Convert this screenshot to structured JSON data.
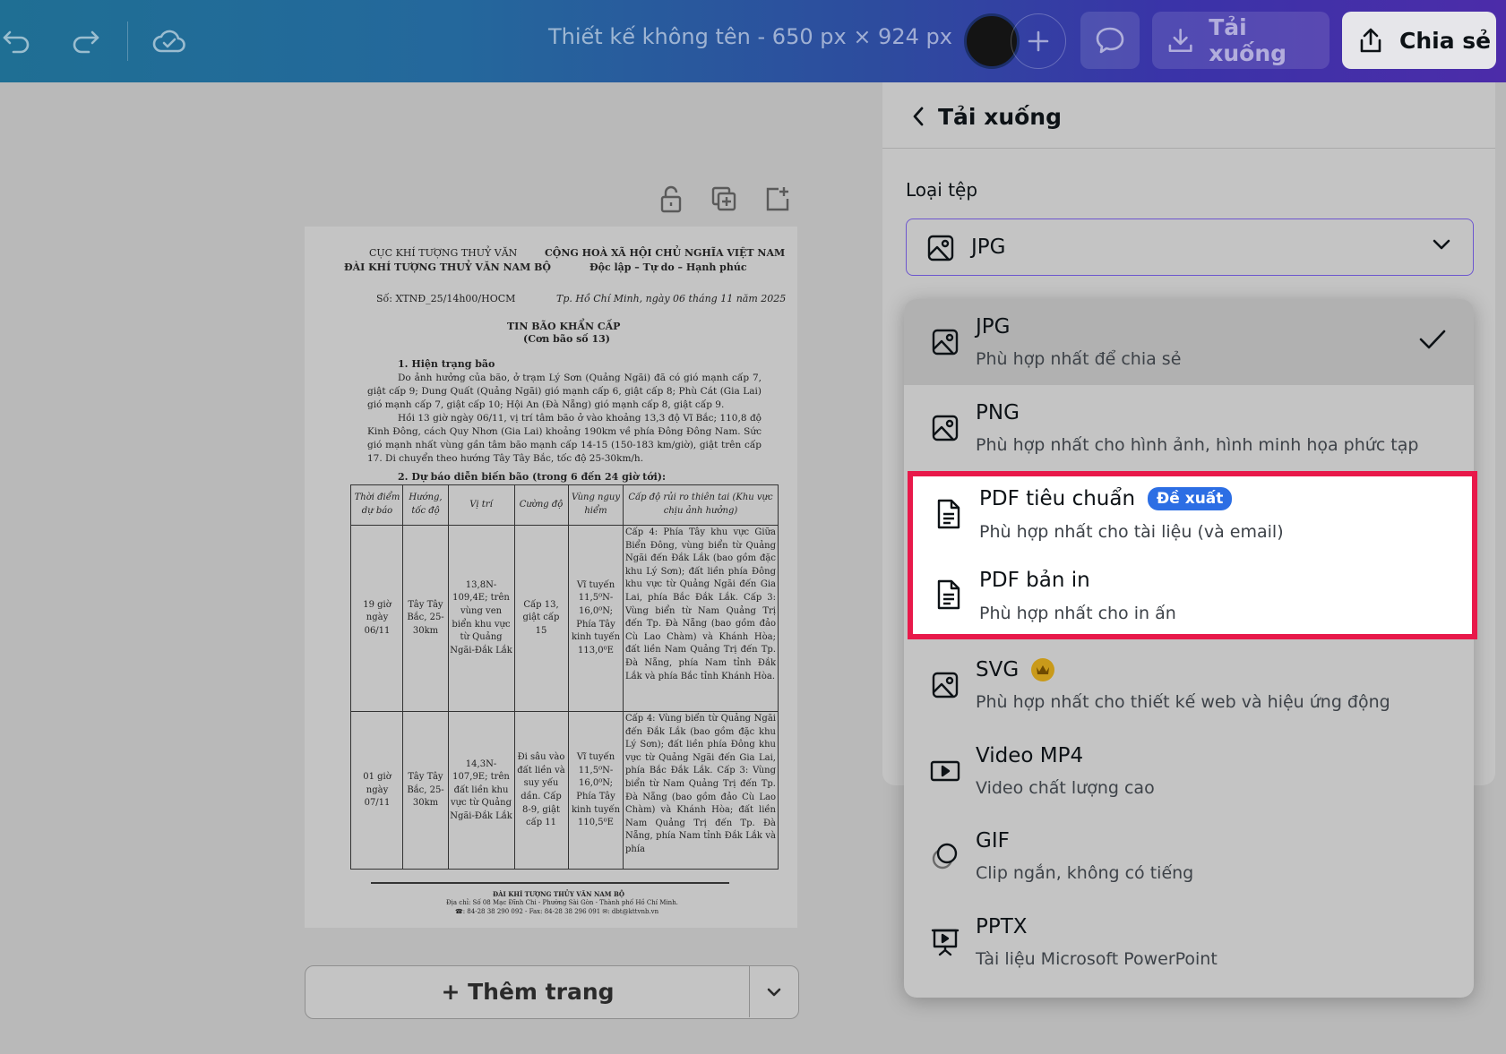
{
  "topbar": {
    "title": "Thiết kế không tên - 650 px × 924 px",
    "download_label": "Tải xuống",
    "share_label": "Chia sẻ"
  },
  "canvas": {
    "add_page_label": "+ Thêm trang"
  },
  "document": {
    "org_left_1": "CỤC KHÍ TƯỢNG THUỶ VĂN",
    "org_left_2": "ĐÀI KHÍ TƯỢNG THUỶ VĂN NAM BỘ",
    "org_right_1": "CỘNG HOÀ XÃ HỘI CHỦ NGHĨA VIỆT NAM",
    "org_right_2": "Độc lập – Tự do – Hạnh phúc",
    "number": "Số: XTNĐ_25/14h00/HOCM",
    "date": "Tp. Hồ Chí Minh, ngày 06 tháng 11 năm 2025",
    "heading_1": "TIN BÃO KHẨN CẤP",
    "heading_2": "(Cơn bão số 13)",
    "section_1": "1.  Hiện trạng bão",
    "para_1": "Do ảnh hưởng của bão, ở trạm Lý Sơn (Quảng Ngãi) đã có gió mạnh cấp 7, giật cấp 9; Dung Quất (Quảng Ngãi) gió mạnh cấp 6, giật cấp 8; Phù Cát (Gia Lai) gió mạnh cấp 7, giật cấp 10; Hội An (Đà Nẵng) gió mạnh cấp 8, giật cấp 9.",
    "para_2": "Hồi 13 giờ ngày 06/11, vị trí tâm bão ở vào khoảng 13,3 độ Vĩ Bắc; 110,8 độ Kinh Đông, cách Quy Nhơn (Gia Lai) khoảng 190km về phía Đông Đông Nam. Sức gió mạnh nhất vùng gần tâm bão mạnh cấp 14-15 (150-183 km/giờ), giật trên cấp 17. Di chuyển theo hướng Tây Tây Bắc, tốc độ 25-30km/h.",
    "section_2": "2. Dự báo diễn biến bão (trong 6 đến 24 giờ tới):",
    "table_header": [
      "Thời điểm dự báo",
      "Hướng, tốc độ",
      "Vị trí",
      "Cường độ",
      "Vùng nguy hiểm",
      "Cấp độ rủi ro thiên tai (Khu vực chịu ảnh hưởng)"
    ],
    "row_1": [
      "19 giờ ngày 06/11",
      "Tây Tây Bắc, 25-30km",
      "13,8N-109,4E; trên vùng ven biển khu vực từ Quảng Ngãi-Đắk Lắk",
      "Cấp 13, giật cấp 15",
      "Vĩ tuyến 11,5⁰N-16,0⁰N; Phía Tây kinh tuyến 113,0⁰E",
      "Cấp 4: Phía Tây khu vực Giữa Biển Đông, vùng biển từ Quảng Ngãi đến Đắk Lắk (bao gồm đặc khu Lý Sơn); đất liền phía Đông khu vực từ Quảng Ngãi đến Gia Lai, phía Bắc Đắk Lắk. Cấp 3: Vùng biển từ Nam Quảng Trị đến Tp. Đà Nẵng (bao gồm đảo Cù Lao Chàm) và Khánh Hòa; đất liền Nam Quảng Trị đến Tp. Đà Nẵng, phía Nam tỉnh Đắk Lắk và phía Bắc tỉnh Khánh Hòa."
    ],
    "row_2": [
      "01 giờ ngày 07/11",
      "Tây Tây Bắc, 25-30km",
      "14,3N-107,9E; trên đất liền khu vực từ Quảng Ngãi-Đắk Lắk",
      "Đi sâu vào đất liền và suy yếu dần. Cấp 8-9, giật cấp 11",
      "Vĩ tuyến 11,5⁰N-16,0⁰N; Phía Tây kinh tuyến 110,5⁰E",
      "Cấp 4: Vùng biển từ Quảng Ngãi đến Đắk Lắk (bao gồm đặc khu Lý Sơn); đất liền phía Đông khu vực từ Quảng Ngãi đến Gia Lai, phía Bắc Đắk Lắk. Cấp 3: Vùng biển từ Nam Quảng Trị đến Tp. Đà Nẵng (bao gồm đảo Cù Lao Chàm) và Khánh Hòa; đất liền Nam Quảng Trị đến Tp. Đà Nẵng, phía Nam tỉnh Đắk Lắk và phía"
    ],
    "footer_1": "ĐÀI KHÍ TƯỢNG THỦY VĂN NAM BỘ",
    "footer_2": "Địa chỉ: Số 08 Mạc Đĩnh Chi - Phường Sài Gòn - Thành phố Hồ Chí Minh.",
    "footer_3": "☎: 84-28 38 290 092 - Fax: 84-28 38 296 091    ✉: dbt@kttvnb.vn"
  },
  "panel": {
    "title": "Tải xuống",
    "file_type_label": "Loại tệp",
    "selected_value": "JPG"
  },
  "options": [
    {
      "name": "JPG",
      "desc": "Phù hợp nhất để chia sẻ",
      "icon": "image-icon"
    },
    {
      "name": "PNG",
      "desc": "Phù hợp nhất cho hình ảnh, hình minh họa phức tạp",
      "icon": "image-icon"
    },
    {
      "name": "PDF tiêu chuẩn",
      "desc": "Phù hợp nhất cho tài liệu (và email)",
      "badge": "Đề xuất",
      "icon": "document-icon"
    },
    {
      "name": "PDF bản in",
      "desc": "Phù hợp nhất cho in ấn",
      "icon": "document-icon"
    },
    {
      "name": "SVG",
      "desc": "Phù hợp nhất cho thiết kế web và hiệu ứng động",
      "icon": "image-icon"
    },
    {
      "name": "Video MP4",
      "desc": "Video chất lượng cao",
      "icon": "video-icon"
    },
    {
      "name": "GIF",
      "desc": "Clip ngắn, không có tiếng",
      "icon": "gif-icon"
    },
    {
      "name": "PPTX",
      "desc": "Tài liệu Microsoft PowerPoint",
      "icon": "presentation-icon"
    }
  ],
  "colors": {
    "highlight_border": "#e8194a",
    "badge": "#2c6ee4",
    "select_border": "#6d56cf"
  }
}
